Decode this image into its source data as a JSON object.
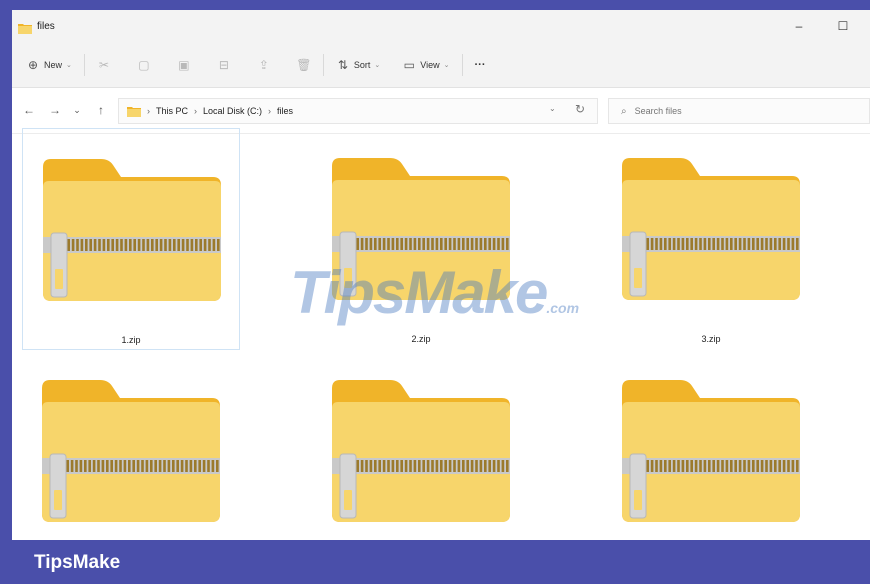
{
  "window": {
    "title": "files",
    "minimize": "–",
    "maximize": "☐"
  },
  "toolbar": {
    "new_label": "New",
    "sort_label": "Sort",
    "view_label": "View",
    "more_label": "···"
  },
  "nav": {
    "back": "←",
    "forward": "→",
    "recent": "⌄",
    "up": "↑"
  },
  "breadcrumb": [
    "This PC",
    "Local Disk (C:)",
    "files"
  ],
  "search": {
    "placeholder": "Search files"
  },
  "files": [
    {
      "name": "1.zip",
      "selected": true
    },
    {
      "name": "2.zip",
      "selected": false
    },
    {
      "name": "3.zip",
      "selected": false
    },
    {
      "name": "",
      "selected": false
    },
    {
      "name": "",
      "selected": false
    },
    {
      "name": "",
      "selected": false
    }
  ],
  "watermark": {
    "main": "TipsMake",
    "suffix": ".com"
  },
  "brand": "TipsMake",
  "colors": {
    "frame_bg": "#4a4faa",
    "folder_front": "#f7d56b",
    "folder_back": "#f0b429",
    "selection": "#cfe3f5"
  }
}
